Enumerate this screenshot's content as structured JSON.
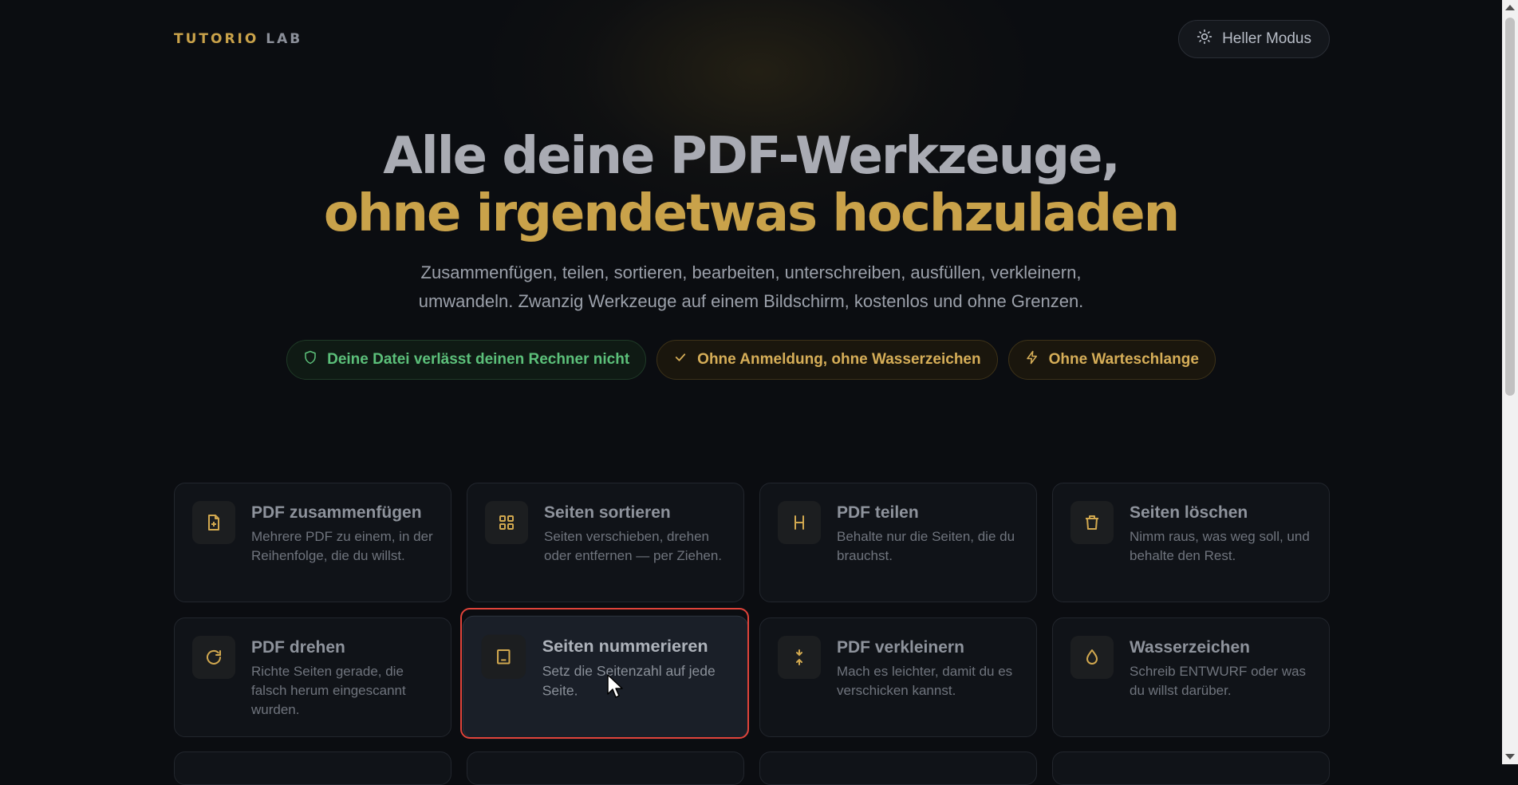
{
  "brand": {
    "part1": "TUTORIO",
    "part2": "LAB"
  },
  "header": {
    "mode_button_label": "Heller Modus",
    "mode_icon": "sun-icon"
  },
  "hero": {
    "title_line1": "Alle deine PDF-Werkzeuge,",
    "title_line2": "ohne irgendetwas hochzuladen",
    "subtitle": "Zusammenfügen, teilen, sortieren, bearbeiten, unterschreiben, ausfüllen, verkleinern, umwandeln. Zwanzig Werkzeuge auf einem Bildschirm, kostenlos und ohne Grenzen."
  },
  "badges": [
    {
      "label": "Deine Datei verlässt deinen Rechner nicht",
      "icon": "shield-icon",
      "color": "#5cc07a"
    },
    {
      "label": "Ohne Anmeldung, ohne Wasserzeichen",
      "icon": "check-icon",
      "color": "#d6ae58"
    },
    {
      "label": "Ohne Warteschlange",
      "icon": "lightning-icon",
      "color": "#d6ae58"
    }
  ],
  "tools": [
    {
      "title": "PDF zusammenfügen",
      "desc": "Mehrere PDF zu einem, in der Reihenfolge, die du willst.",
      "icon": "file-plus-icon"
    },
    {
      "title": "Seiten sortieren",
      "desc": "Seiten verschieben, drehen oder entfernen — per Ziehen.",
      "icon": "grid-icon"
    },
    {
      "title": "PDF teilen",
      "desc": "Behalte nur die Seiten, die du brauchst.",
      "icon": "split-icon"
    },
    {
      "title": "Seiten löschen",
      "desc": "Nimm raus, was weg soll, und behalte den Rest.",
      "icon": "trash-icon"
    },
    {
      "title": "PDF drehen",
      "desc": "Richte Seiten gerade, die falsch herum eingescannt wurden.",
      "icon": "rotate-icon"
    },
    {
      "title": "Seiten nummerieren",
      "desc": "Setz die Seitenzahl auf jede Seite.",
      "icon": "page-number-icon"
    },
    {
      "title": "PDF verkleinern",
      "desc": "Mach es leichter, damit du es verschicken kannst.",
      "icon": "compress-icon"
    },
    {
      "title": "Wasserzeichen",
      "desc": "Schreib ENTWURF oder was du willst darüber.",
      "icon": "drop-icon"
    }
  ],
  "active_tool_index": 5,
  "colors": {
    "accent": "#c9a24a",
    "background": "#0b0d11",
    "highlight": "#e0433a"
  }
}
